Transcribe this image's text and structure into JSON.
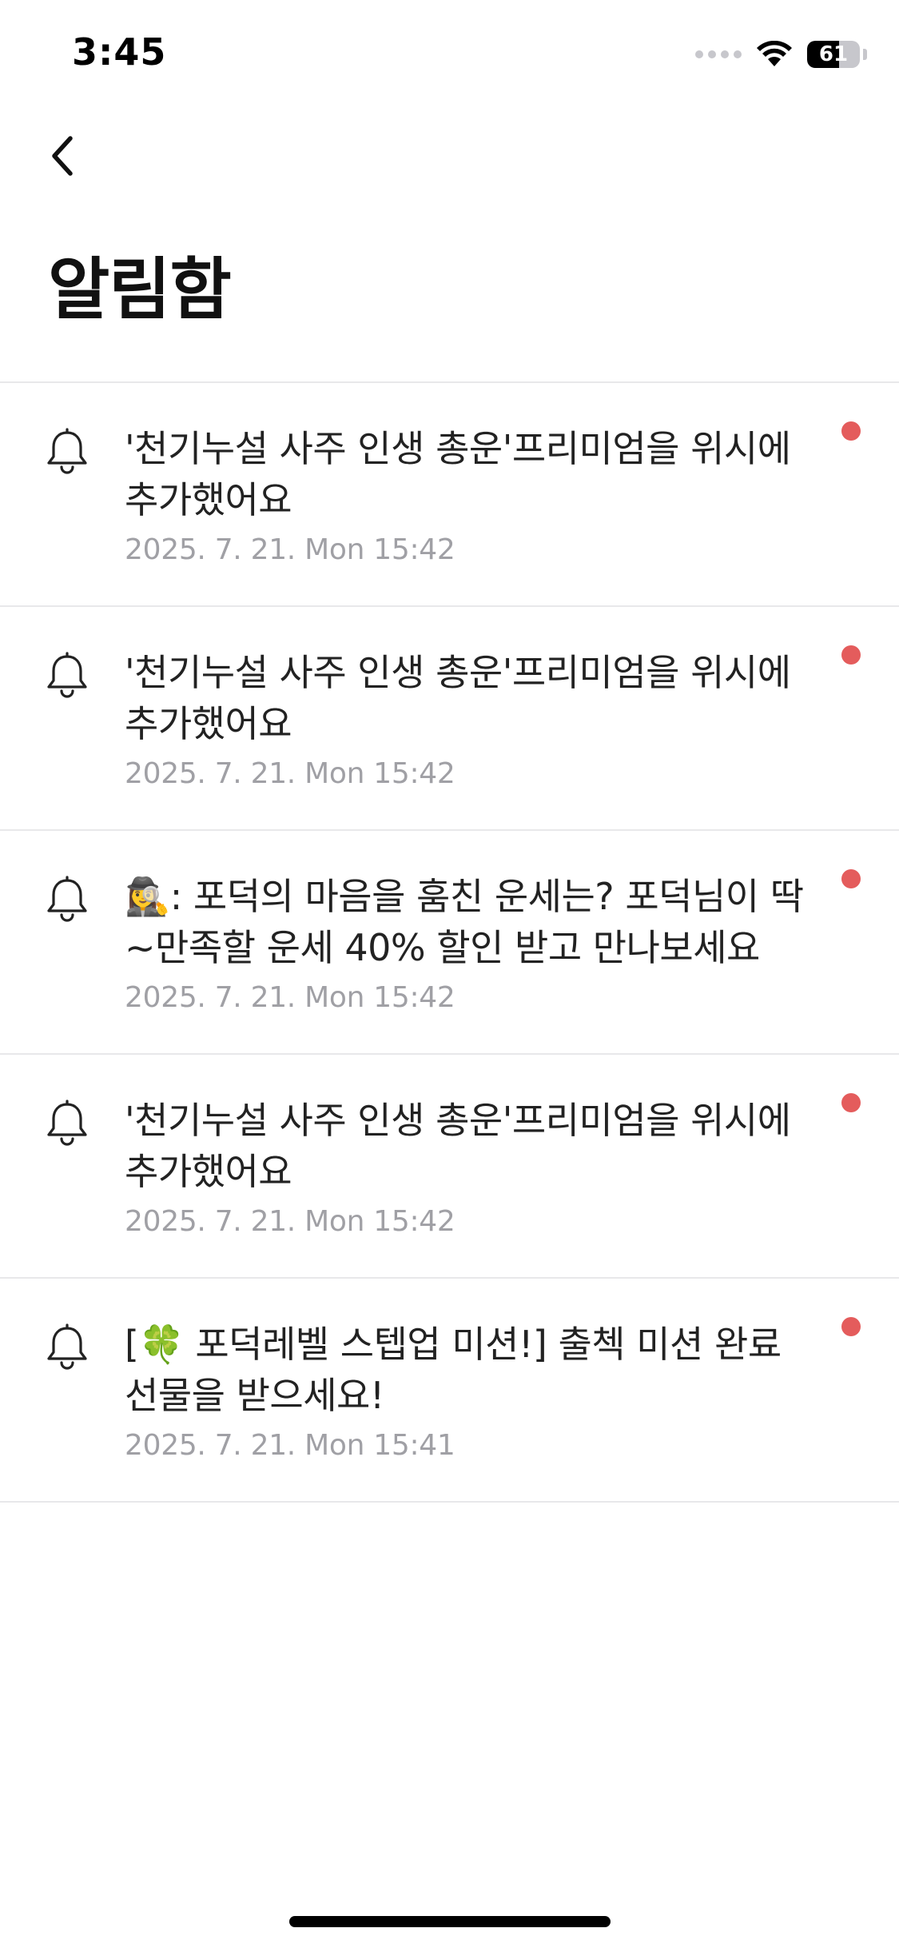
{
  "status_bar": {
    "time": "3:45",
    "battery_level": "61",
    "battery_fraction": 0.61,
    "icons": [
      "signal-icon",
      "wifi-icon",
      "battery-icon"
    ]
  },
  "header": {
    "back_icon": "chevron-left-icon",
    "title": "알림함"
  },
  "colors": {
    "unread_dot": "#e45c5c",
    "divider": "#e8e8ea",
    "timestamp": "#a0a0a5",
    "text": "#222222"
  },
  "notifications": [
    {
      "icon": "bell-icon",
      "text": "'천기누설 사주 인생 총운'프리미엄을 위시에 추가했어요",
      "time": "2025. 7. 21. Mon 15:42",
      "unread": true
    },
    {
      "icon": "bell-icon",
      "text": "'천기누설 사주 인생 총운'프리미엄을 위시에 추가했어요",
      "time": "2025. 7. 21. Mon 15:42",
      "unread": true
    },
    {
      "icon": "bell-icon",
      "text": "🕵️‍♀️: 포덕의 마음을 훔친 운세는? 포덕님이 딱~만족할 운세 40% 할인 받고 만나보세요",
      "time": "2025. 7. 21. Mon 15:42",
      "unread": true
    },
    {
      "icon": "bell-icon",
      "text": "'천기누설 사주 인생 총운'프리미엄을 위시에 추가했어요",
      "time": "2025. 7. 21. Mon 15:42",
      "unread": true
    },
    {
      "icon": "bell-icon",
      "text": "[🍀 포덕레벨 스텝업 미션!] 출첵 미션 완료 선물을 받으세요!",
      "time": "2025. 7. 21. Mon 15:41",
      "unread": true
    }
  ]
}
